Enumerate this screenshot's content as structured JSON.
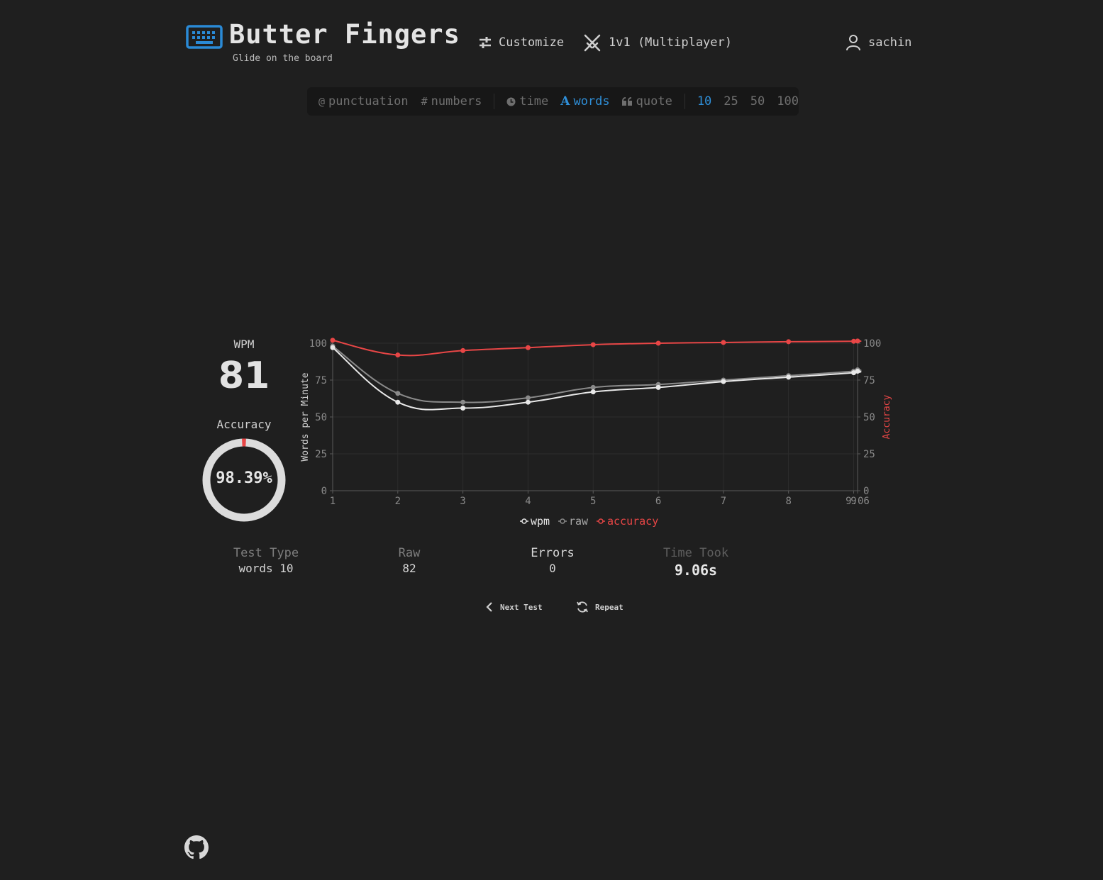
{
  "header": {
    "logo_icon": "keyboard-icon",
    "title": "Butter Fingers",
    "subtitle": "Glide on the board",
    "nav": {
      "customize": {
        "label": "Customize",
        "icon": "sliders-icon"
      },
      "multiplayer": {
        "label": "1v1 (Multiplayer)",
        "icon": "crossed-swords-icon"
      },
      "user": {
        "label": "sachin",
        "icon": "user-icon"
      }
    }
  },
  "mode_bar": {
    "punctuation": {
      "symbol": "@",
      "label": "punctuation"
    },
    "numbers": {
      "symbol": "#",
      "label": "numbers"
    },
    "time": {
      "label": "time"
    },
    "words": {
      "symbol": "A",
      "label": "words",
      "active": true
    },
    "quote": {
      "label": "quote"
    },
    "counts": [
      "10",
      "25",
      "50",
      "100"
    ],
    "active_count": "10",
    "accent_color": "#2f8fd8"
  },
  "results": {
    "wpm_label": "WPM",
    "wpm_value": "81",
    "accuracy_label": "Accuracy",
    "accuracy_value": "98.39%",
    "accuracy_fraction": 0.9839
  },
  "stats": {
    "test_type": {
      "label": "Test Type",
      "value": "words 10"
    },
    "raw": {
      "label": "Raw",
      "value": "82"
    },
    "errors": {
      "label": "Errors",
      "value": "0"
    },
    "time_took": {
      "label": "Time Took",
      "value": "9.06s"
    }
  },
  "actions": {
    "next_test": "Next Test",
    "repeat": "Repeat"
  },
  "footer": {
    "github_icon": "github-icon"
  },
  "chart_data": {
    "type": "line",
    "x": [
      1,
      2,
      3,
      4,
      5,
      6,
      7,
      8,
      9,
      9.06
    ],
    "x_tick_labels": [
      "1",
      "2",
      "3",
      "4",
      "5",
      "6",
      "7",
      "8",
      "9",
      "9.06"
    ],
    "ylabel": "Words per Minute",
    "y2label": "Accuracy",
    "ylim": [
      0,
      100
    ],
    "y2lim": [
      0,
      100
    ],
    "y_ticks": [
      "0",
      "25",
      "50",
      "75",
      "100"
    ],
    "grid": true,
    "legend_position": "bottom",
    "series": [
      {
        "name": "wpm",
        "axis": "left",
        "color": "#e8e8e8",
        "values": [
          97,
          60,
          56,
          60,
          67,
          70,
          74,
          77,
          80,
          81
        ]
      },
      {
        "name": "raw",
        "axis": "left",
        "color": "#8a8a8a",
        "values": [
          98,
          66,
          60,
          63,
          70,
          72,
          75,
          78,
          81,
          82
        ]
      },
      {
        "name": "accuracy",
        "axis": "right",
        "color": "#e84646",
        "values": [
          102,
          92,
          95,
          97,
          99,
          100,
          100.5,
          101,
          101.3,
          101.5
        ]
      }
    ]
  }
}
